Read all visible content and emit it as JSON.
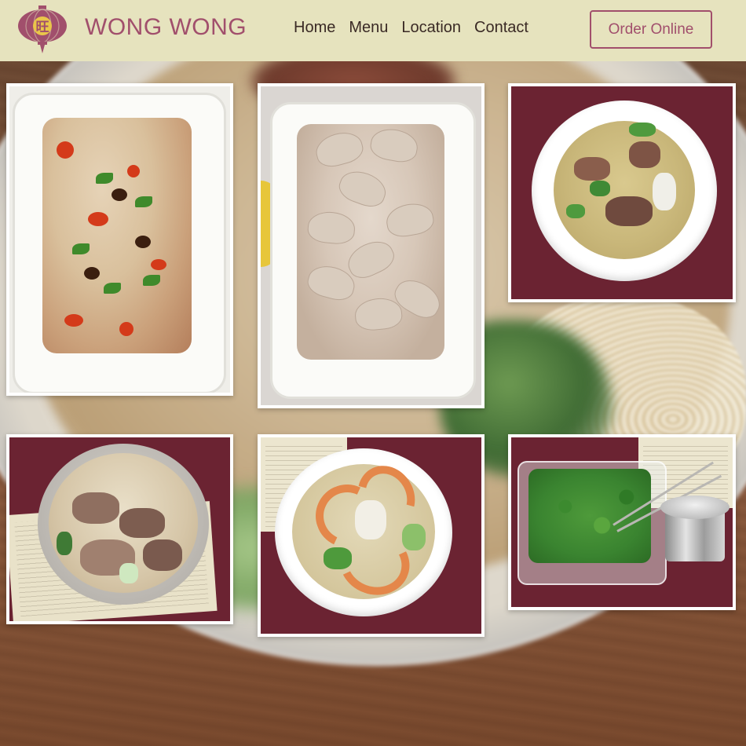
{
  "brand": {
    "name": "WONG WONG",
    "logo_char": "旺"
  },
  "nav": {
    "items": [
      "Home",
      "Menu",
      "Location",
      "Contact"
    ]
  },
  "cta": {
    "label": "Order Online"
  },
  "gallery": {
    "photos": [
      "spicy-dumplings-photo",
      "plain-dumplings-photo",
      "lamb-soup-photo",
      "beef-noodle-soup-photo",
      "shrimp-soup-photo",
      "cilantro-photo"
    ]
  },
  "colors": {
    "header_bg": "#e6e3be",
    "brand": "#a14f6c",
    "nav_text": "#3a2a25"
  }
}
